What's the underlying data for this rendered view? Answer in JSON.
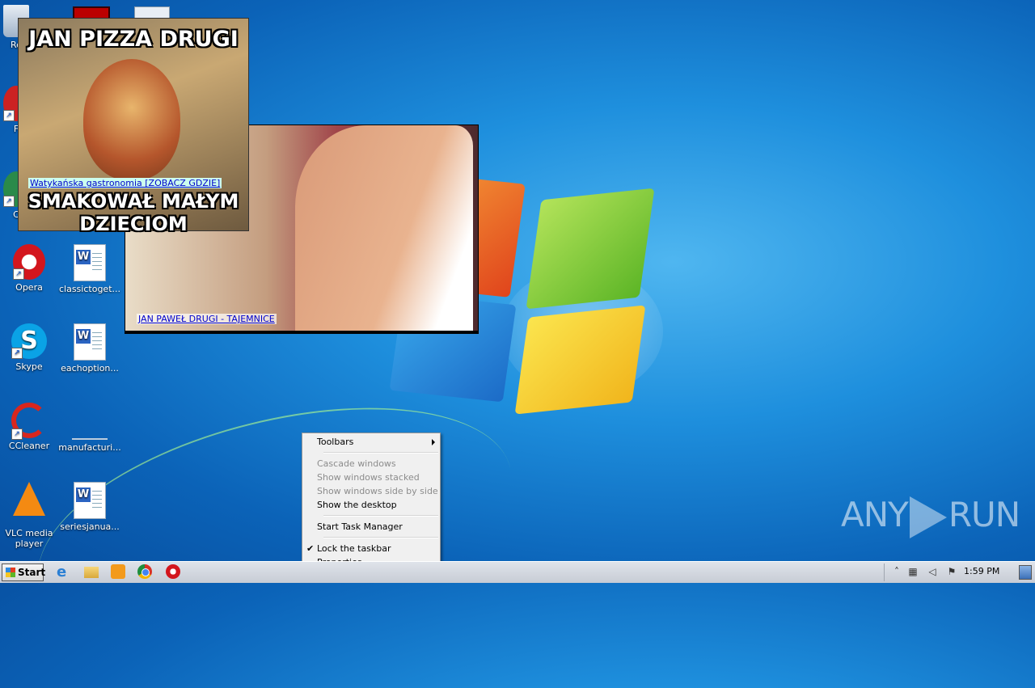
{
  "desktop_icons": [
    {
      "label": "Re",
      "icon": "recycle-bin-icon"
    },
    {
      "label": "F",
      "icon": "app-icon"
    },
    {
      "label": "C",
      "icon": "app-icon"
    },
    {
      "label": "Opera",
      "icon": "opera-icon"
    },
    {
      "label": "classictoget...",
      "icon": "word-document-icon"
    },
    {
      "label": "Skype",
      "icon": "skype-icon"
    },
    {
      "label": "eachoption...",
      "icon": "word-document-icon"
    },
    {
      "label": "CCleaner",
      "icon": "ccleaner-icon"
    },
    {
      "label": "manufacturi...",
      "icon": "blank-document-icon"
    },
    {
      "label": "VLC media player",
      "icon": "vlc-icon"
    },
    {
      "label": "seriesjanua...",
      "icon": "word-document-icon"
    }
  ],
  "ad_top": {
    "headline": "JAN PIZZA DRUGI",
    "link": "Watykańska gastronomia [ZOBACZ GDZIE]",
    "caption": "SMAKOWAŁ MAŁYM DZIECIOM"
  },
  "ad_bottom": {
    "link": "JAN PAWEŁ DRUGI - TAJEMNICE"
  },
  "context_menu": {
    "toolbars": "Toolbars",
    "cascade": "Cascade windows",
    "stacked": "Show windows stacked",
    "side_by_side": "Show windows side by side",
    "show_desktop": "Show the desktop",
    "task_manager": "Start Task Manager",
    "lock_taskbar": "Lock the taskbar",
    "lock_checked": "✔",
    "properties": "Properties"
  },
  "taskbar": {
    "start_label": "Start",
    "pinned": [
      "internet-explorer-icon",
      "windows-explorer-icon",
      "media-player-icon",
      "chrome-icon",
      "opera-icon"
    ],
    "clock": "1:59 PM"
  },
  "watermark": {
    "left": "ANY",
    "right": "RUN"
  }
}
